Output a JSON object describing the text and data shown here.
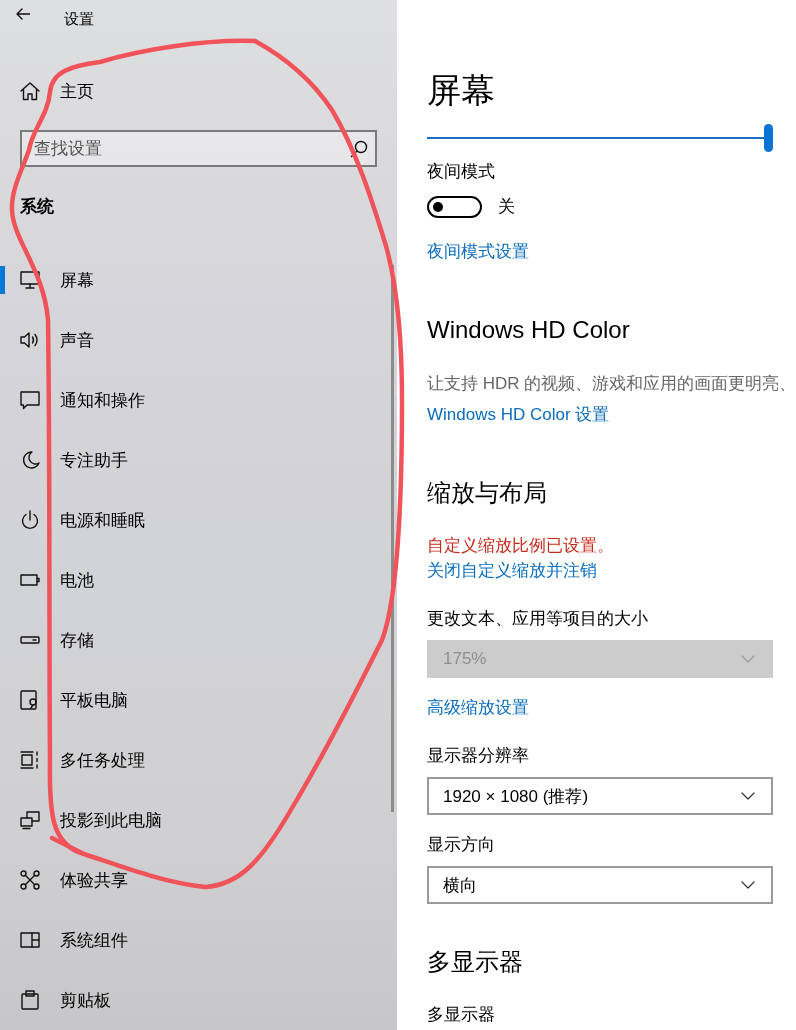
{
  "window": {
    "title": "设置"
  },
  "sidebar": {
    "home": "主页",
    "search": {
      "placeholder": "查找设置"
    },
    "category": "系统",
    "items": [
      {
        "label": "屏幕",
        "selected": true
      },
      {
        "label": "声音",
        "selected": false
      },
      {
        "label": "通知和操作",
        "selected": false
      },
      {
        "label": "专注助手",
        "selected": false
      },
      {
        "label": "电源和睡眠",
        "selected": false
      },
      {
        "label": "电池",
        "selected": false
      },
      {
        "label": "存储",
        "selected": false
      },
      {
        "label": "平板电脑",
        "selected": false
      },
      {
        "label": "多任务处理",
        "selected": false
      },
      {
        "label": "投影到此电脑",
        "selected": false
      },
      {
        "label": "体验共享",
        "selected": false
      },
      {
        "label": "系统组件",
        "selected": false
      },
      {
        "label": "剪贴板",
        "selected": false
      }
    ]
  },
  "content": {
    "title": "屏幕",
    "items": [
      {
        "kind": "slider",
        "level": 1
      },
      {
        "kind": "label",
        "text": "夜间模式"
      },
      {
        "kind": "toggle",
        "on": false,
        "state_text": "关"
      },
      {
        "kind": "link",
        "text": "夜间模式设置"
      },
      {
        "kind": "heading",
        "text": "Windows HD Color"
      },
      {
        "kind": "description",
        "text": "让支持 HDR 的视频、游戏和应用的画面更明亮、"
      },
      {
        "kind": "link",
        "text": "Windows HD Color 设置"
      },
      {
        "kind": "heading",
        "text": "缩放与布局"
      },
      {
        "kind": "warning",
        "text": "自定义缩放比例已设置。"
      },
      {
        "kind": "link",
        "text": "关闭自定义缩放并注销"
      },
      {
        "kind": "label",
        "text": "更改文本、应用等项目的大小"
      },
      {
        "kind": "dropdown",
        "value": "175%",
        "disabled": true
      },
      {
        "kind": "link",
        "text": "高级缩放设置"
      },
      {
        "kind": "label",
        "text": "显示器分辨率"
      },
      {
        "kind": "dropdown",
        "value": "1920 × 1080 (推荐)",
        "disabled": false
      },
      {
        "kind": "label",
        "text": "显示方向"
      },
      {
        "kind": "dropdown",
        "value": "横向",
        "disabled": false
      },
      {
        "kind": "heading",
        "text": "多显示器"
      },
      {
        "kind": "label",
        "text": "多显示器"
      }
    ]
  },
  "annotation": {
    "kind": "freehand-loop"
  }
}
